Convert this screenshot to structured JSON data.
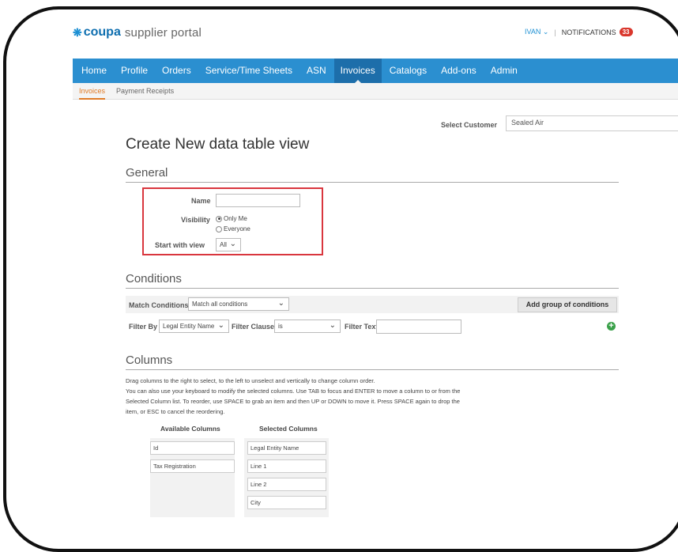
{
  "header": {
    "logo_mark": "❋",
    "logo_brand": "coupa",
    "logo_rest": "supplier portal",
    "user": "IVAN",
    "user_caret": "⌄",
    "separator": "|",
    "notifications_label": "NOTIFICATIONS",
    "notifications_count": "33"
  },
  "nav": {
    "items": [
      "Home",
      "Profile",
      "Orders",
      "Service/Time Sheets",
      "ASN",
      "Invoices",
      "Catalogs",
      "Add-ons",
      "Admin"
    ],
    "active": "Invoices"
  },
  "subnav": {
    "items": [
      "Invoices",
      "Payment Receipts"
    ],
    "active": "Invoices"
  },
  "customer": {
    "label": "Select Customer",
    "value": "Sealed Air"
  },
  "page_title": "Create New data table view",
  "general": {
    "heading": "General",
    "name_label": "Name",
    "name_value": "",
    "visibility_label": "Visibility",
    "visibility_options": [
      "Only Me",
      "Everyone"
    ],
    "visibility_selected": "Only Me",
    "start_with_view_label": "Start with view",
    "start_with_view_value": "All"
  },
  "conditions": {
    "heading": "Conditions",
    "match_label": "Match Conditions",
    "match_value": "Match all conditions",
    "add_group_button": "Add group of conditions",
    "filter_by_label": "Filter By",
    "filter_by_value": "Legal Entity Name",
    "filter_clause_label": "Filter Clause",
    "filter_clause_value": "is",
    "filter_text_label": "Filter Text",
    "filter_text_value": "",
    "add_icon": "+"
  },
  "columns": {
    "heading": "Columns",
    "instructions": [
      "Drag columns to the right to select, to the left to unselect and vertically to change column order.",
      "You can also use your keyboard to modify the selected columns. Use TAB to focus and ENTER to move a column to or from the",
      "Selected Column list. To reorder, use SPACE to grab an item and then UP or DOWN to move it. Press SPACE again to drop the",
      "item, or ESC to cancel the reordering."
    ],
    "available_heading": "Available Columns",
    "selected_heading": "Selected Columns",
    "available": [
      "Id",
      "Tax Registration"
    ],
    "selected": [
      "Legal Entity Name",
      "Line 1",
      "Line 2",
      "City"
    ]
  },
  "colors": {
    "nav_bg": "#2b8fd0",
    "nav_active": "#1d6eaa",
    "subnav_active": "#e07b27",
    "highlight_box": "#d9363e",
    "badge": "#d9362c",
    "add_icon": "#3ba14a"
  }
}
